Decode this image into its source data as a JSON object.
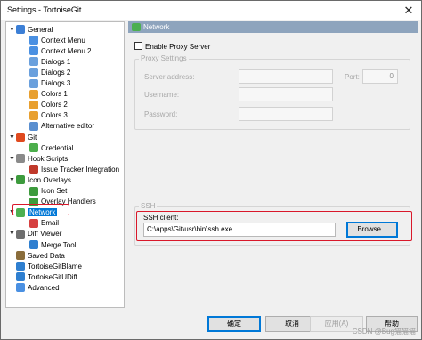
{
  "window": {
    "title": "Settings - TortoiseGit"
  },
  "tree": {
    "items": [
      {
        "label": "General",
        "level": 0,
        "toggle": "▼",
        "color": "#3c7fd6"
      },
      {
        "label": "Context Menu",
        "level": 1,
        "toggle": "",
        "color": "#4a90e2"
      },
      {
        "label": "Context Menu 2",
        "level": 1,
        "toggle": "",
        "color": "#4a90e2"
      },
      {
        "label": "Dialogs 1",
        "level": 1,
        "toggle": "",
        "color": "#6aa0dd"
      },
      {
        "label": "Dialogs 2",
        "level": 1,
        "toggle": "",
        "color": "#6aa0dd"
      },
      {
        "label": "Dialogs 3",
        "level": 1,
        "toggle": "",
        "color": "#6aa0dd"
      },
      {
        "label": "Colors 1",
        "level": 1,
        "toggle": "",
        "color": "#e8a030"
      },
      {
        "label": "Colors 2",
        "level": 1,
        "toggle": "",
        "color": "#e8a030"
      },
      {
        "label": "Colors 3",
        "level": 1,
        "toggle": "",
        "color": "#e8a030"
      },
      {
        "label": "Alternative editor",
        "level": 1,
        "toggle": "",
        "color": "#5a8fd0"
      },
      {
        "label": "Git",
        "level": 0,
        "toggle": "▼",
        "color": "#e04a1f"
      },
      {
        "label": "Credential",
        "level": 1,
        "toggle": "",
        "color": "#4cae4c"
      },
      {
        "label": "Hook Scripts",
        "level": 0,
        "toggle": "▼",
        "color": "#8a8a8a"
      },
      {
        "label": "Issue Tracker Integration",
        "level": 1,
        "toggle": "",
        "color": "#c0392b"
      },
      {
        "label": "Icon Overlays",
        "level": 0,
        "toggle": "▼",
        "color": "#3d9b3d"
      },
      {
        "label": "Icon Set",
        "level": 1,
        "toggle": "",
        "color": "#3d9b3d"
      },
      {
        "label": "Overlay Handlers",
        "level": 1,
        "toggle": "",
        "color": "#3d9b3d"
      },
      {
        "label": "Network",
        "level": 0,
        "toggle": "▼",
        "color": "#4caf50",
        "selected": true
      },
      {
        "label": "Email",
        "level": 1,
        "toggle": "",
        "color": "#d64040"
      },
      {
        "label": "Diff Viewer",
        "level": 0,
        "toggle": "▼",
        "color": "#6f6f6f"
      },
      {
        "label": "Merge Tool",
        "level": 1,
        "toggle": "",
        "color": "#2f7fd0"
      },
      {
        "label": "Saved Data",
        "level": 0,
        "toggle": "",
        "color": "#8a6d3b"
      },
      {
        "label": "TortoiseGitBlame",
        "level": 0,
        "toggle": "",
        "color": "#2f7fd0"
      },
      {
        "label": "TortoiseGitUDiff",
        "level": 0,
        "toggle": "",
        "color": "#2f7fd0"
      },
      {
        "label": "Advanced",
        "level": 0,
        "toggle": "",
        "color": "#4a90e2"
      }
    ]
  },
  "panel": {
    "header": "Network",
    "enable_proxy_label": "Enable Proxy Server",
    "proxy_group_title": "Proxy Settings",
    "server_address_label": "Server address:",
    "port_label": "Port:",
    "port_value": "0",
    "username_label": "Username:",
    "password_label": "Password:",
    "ssh_group_title": "SSH",
    "ssh_client_label": "SSH client:",
    "ssh_client_value": "C:\\apps\\Git\\usr\\bin\\ssh.exe",
    "browse_label": "Browse..."
  },
  "buttons": {
    "ok": "确定",
    "cancel": "取消",
    "apply": "应用(A)",
    "help": "帮助"
  },
  "watermark": "CSDN @Bug猫猫猫"
}
